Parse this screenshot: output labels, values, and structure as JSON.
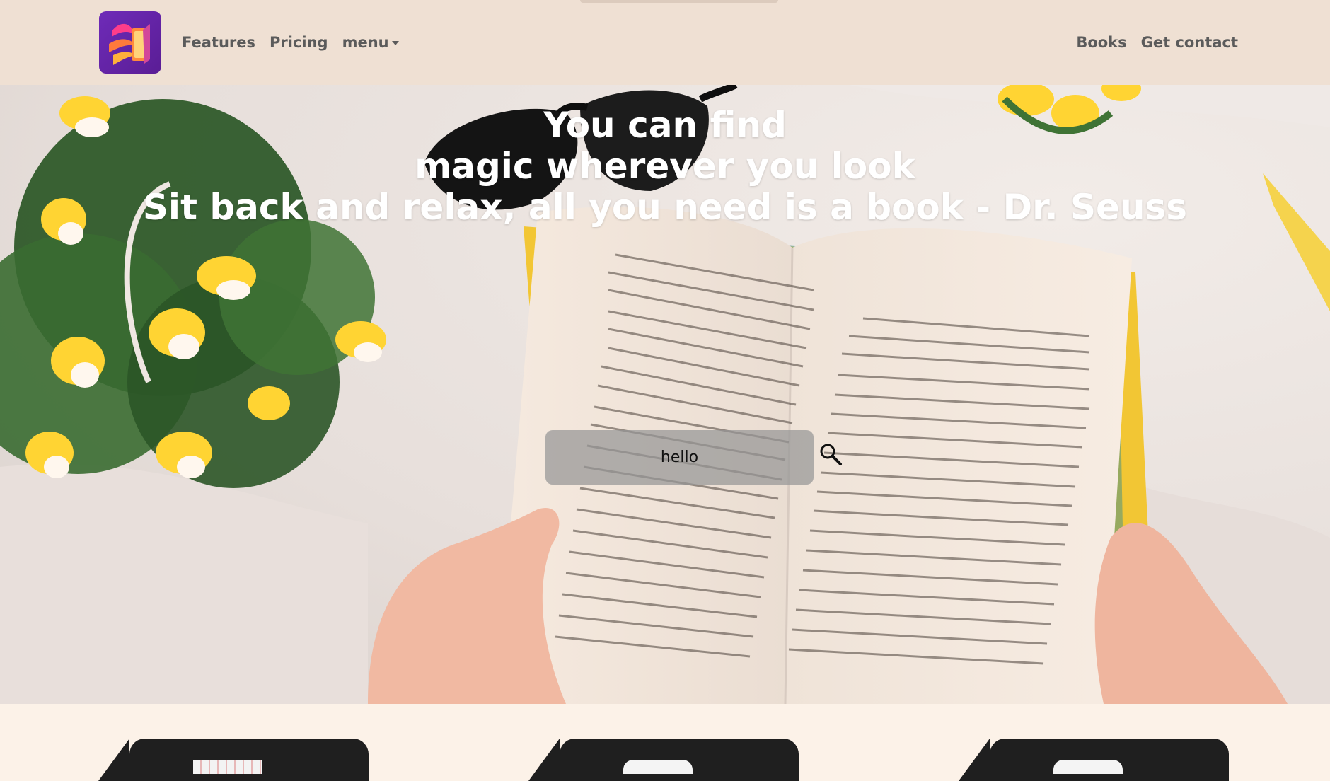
{
  "nav": {
    "left_items": [
      {
        "label": "Features"
      },
      {
        "label": "Pricing"
      },
      {
        "label": "menu"
      }
    ],
    "right_items": [
      {
        "label": "Books"
      },
      {
        "label": "Get contact"
      }
    ]
  },
  "hero": {
    "title_line1": "You can find",
    "title_line2": "magic wherever you look",
    "title_line3": "Sit back and relax, all you need is a book - Dr. Seuss"
  },
  "search": {
    "value": "hello"
  },
  "colors": {
    "navbar": "#efe0d3",
    "nav_text": "#5b5b5b",
    "page_bg": "#fcf2e8",
    "hero_text": "#ffffff",
    "card": "#1f1f1f",
    "logo": "#6e2bb8"
  },
  "icons": {
    "logo": "book-with-wings-logo",
    "search": "search-icon"
  }
}
